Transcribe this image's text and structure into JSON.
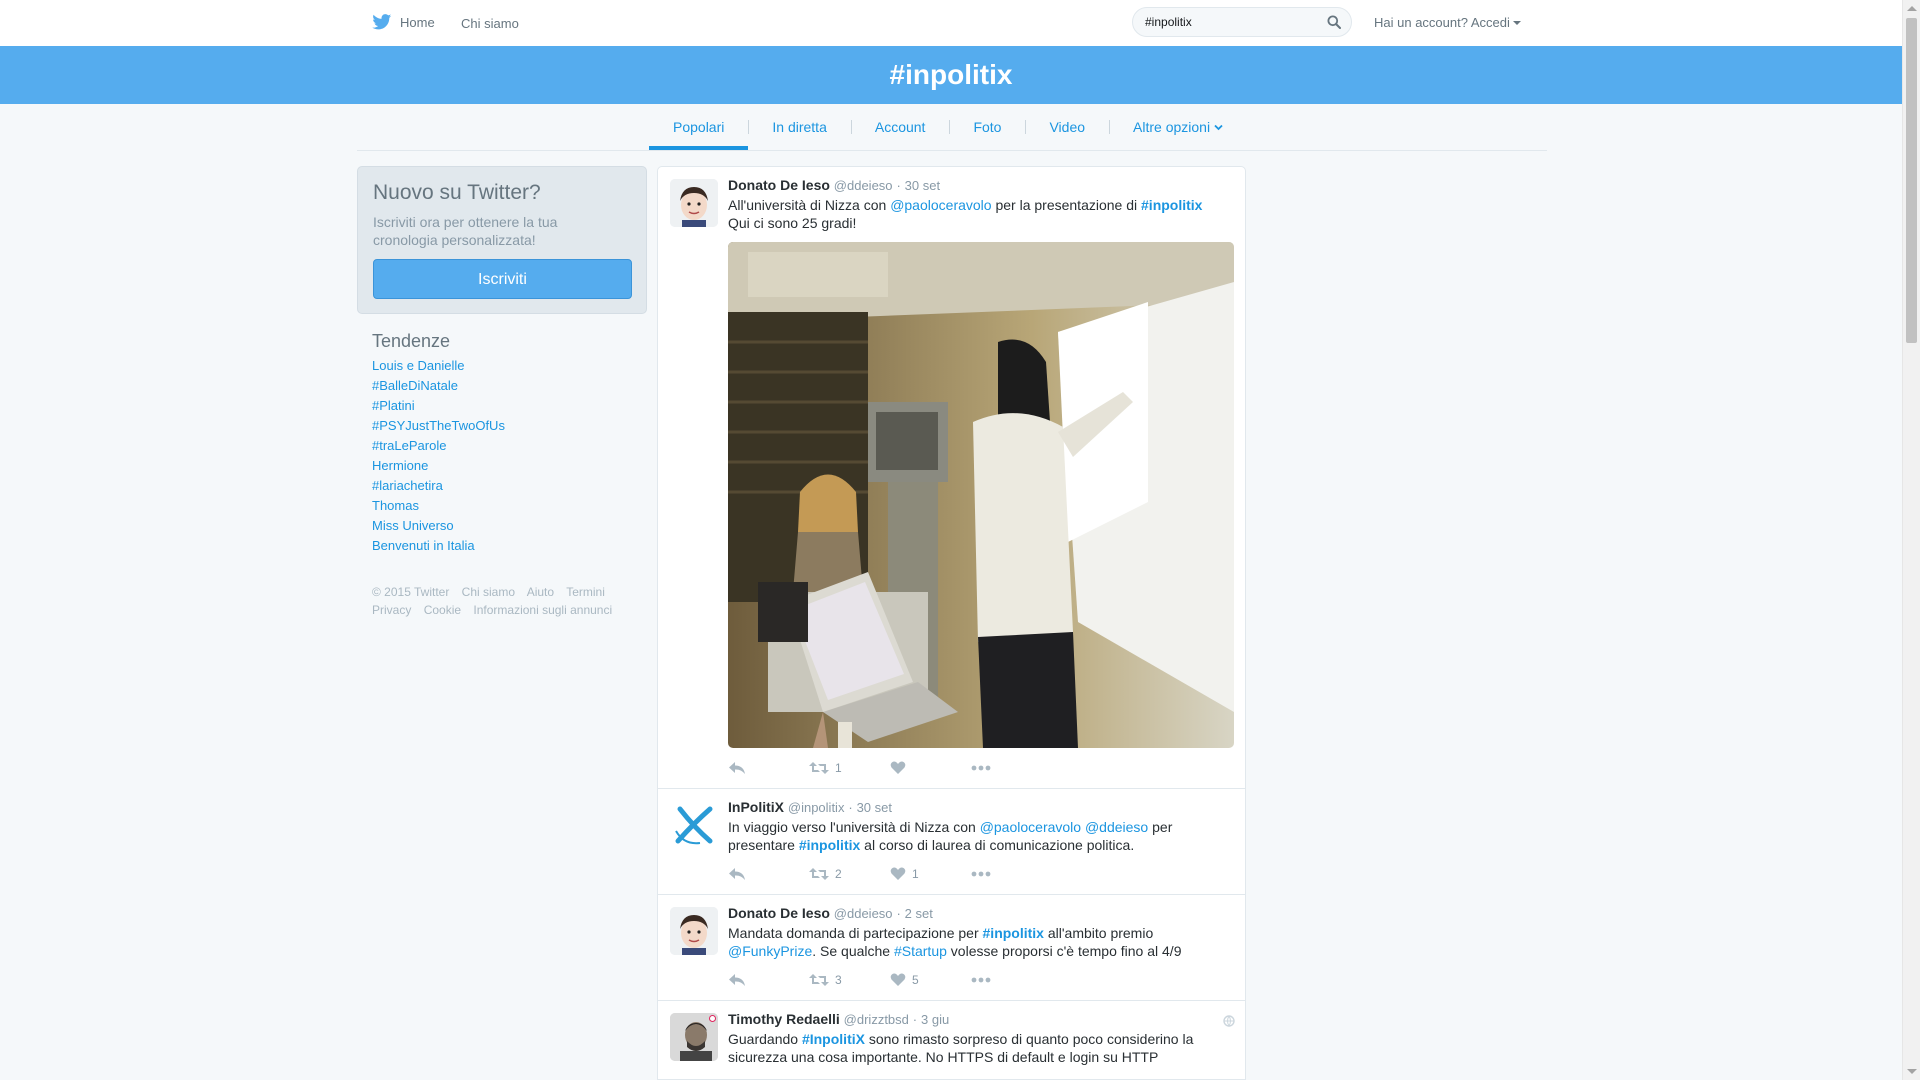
{
  "nav": {
    "home_label": "Home",
    "about_label": "Chi siamo",
    "search_value": "#inpolitix",
    "login_label": "Hai un account? Accedi"
  },
  "banner": {
    "title": "#inpolitix"
  },
  "tabs": [
    {
      "label": "Popolari",
      "active": true
    },
    {
      "label": "In diretta"
    },
    {
      "label": "Account"
    },
    {
      "label": "Foto"
    },
    {
      "label": "Video"
    },
    {
      "label": "Altre opzioni"
    }
  ],
  "signup": {
    "title": "Nuovo su Twitter?",
    "text": "Iscriviti ora per ottenere la tua cronologia personalizzata!",
    "button_label": "Iscriviti"
  },
  "trends": {
    "title": "Tendenze",
    "items": [
      "Louis e Danielle",
      "#BalleDiNatale",
      "#Platini",
      "#PSYJustTheTwoOfUs",
      "#traLeParole",
      "Hermione",
      "#lariachetira",
      "Thomas",
      "Miss Universo",
      "Benvenuti in Italia"
    ]
  },
  "footer": {
    "row1": [
      "© 2015 Twitter",
      "Chi siamo",
      "Aiuto",
      "Termini"
    ],
    "row2": [
      "Privacy",
      "Cookie",
      "Informazioni sugli annunci"
    ]
  },
  "tweets": [
    {
      "name": "Donato De Ieso",
      "handle": "@ddeieso",
      "time": "30 set",
      "text_parts": [
        "All'università di Nizza con ",
        "@paoloceravolo",
        " per la presentazione di ",
        "#inpolitix",
        "Qui ci sono 25 gradi!"
      ],
      "retweets": "1",
      "likes": ""
    },
    {
      "name": "InPolitiX",
      "handle": "@inpolitix",
      "time": "30 set",
      "text_parts": [
        "In viaggio verso l'università di Nizza con ",
        "@paoloceravolo",
        " ",
        "@ddeieso",
        " per presentare ",
        "#inpolitix",
        " al corso di laurea di comunicazione politica."
      ],
      "retweets": "2",
      "likes": "1"
    },
    {
      "name": "Donato De Ieso",
      "handle": "@ddeieso",
      "time": "2 set",
      "text_parts": [
        "Mandata domanda di partecipazione per ",
        "#inpolitix",
        " all'ambito premio ",
        "@FunkyPrize",
        ". Se qualche ",
        "#Startup",
        " volesse proporsi c'è tempo fino al 4/9"
      ],
      "retweets": "3",
      "likes": "5"
    },
    {
      "name": "Timothy Redaelli",
      "handle": "@drizztbsd",
      "time": "3 giu",
      "text_parts": [
        "Guardando ",
        "#InpolitiX",
        " sono rimasto sorpreso di quanto poco considerino la sicurezza una cosa importante. No HTTPS di default e login su HTTP"
      ]
    }
  ],
  "colors": {
    "brand_blue": "#55acee",
    "link_blue": "#1b95e0",
    "text": "#292f33",
    "muted": "#8899a6"
  }
}
